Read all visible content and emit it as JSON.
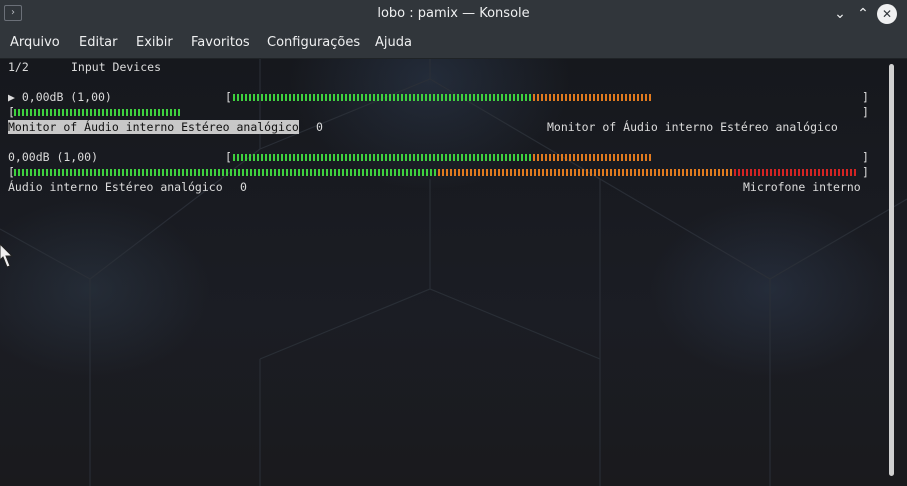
{
  "window": {
    "title": "lobo : pamix — Konsole"
  },
  "menu": {
    "items": [
      "Arquivo",
      "Editar",
      "Exibir",
      "Favoritos",
      "Configurações",
      "Ajuda"
    ]
  },
  "terminal": {
    "header_page": "1/2",
    "header_title": "Input Devices",
    "devices": [
      {
        "volume_line": "▶ 0,00dB (1,00)",
        "name": "Monitor of Áudio interno Estéreo analógico",
        "index": "0",
        "right_label": "Monitor of Áudio interno Estéreo analógico",
        "volume_fraction": 0.7,
        "peak_fraction": 0.2,
        "selected": true
      },
      {
        "volume_line": "0,00dB (1,00)",
        "name": "Áudio interno Estéreo analógico",
        "index": "0",
        "right_label": "Microfone interno",
        "volume_fraction": 0.7,
        "peak_fraction": 1.0,
        "selected": false
      }
    ],
    "bracket_open": "[",
    "bracket_close": "]"
  },
  "colors": {
    "green": "#3fd13f",
    "orange": "#e07a1f",
    "red": "#d42424"
  }
}
